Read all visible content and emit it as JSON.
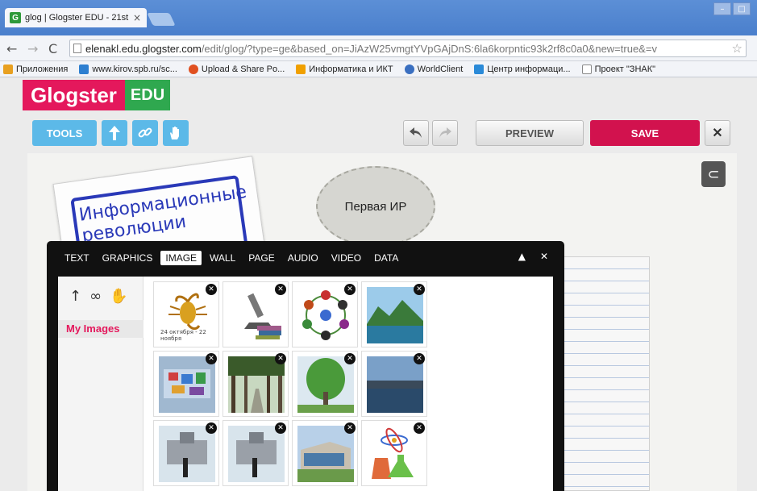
{
  "browser": {
    "tab_title": "glog | Glogster EDU - 21st",
    "tab_close": "×",
    "favicon_letter": "G",
    "url_host": "elenakl.edu.glogster.com",
    "url_path": "/edit/glog/?type=ge&based_on=JiAzW25vmgtYVpGAjDnS:6la6korpntic93k2rf8c0a0&new=true&=v",
    "bookmarks": [
      {
        "label": "Приложения",
        "color": "#e8a020"
      },
      {
        "label": "www.kirov.spb.ru/sc...",
        "color": "#2e7fd0"
      },
      {
        "label": "Upload & Share Po...",
        "color": "#e05020"
      },
      {
        "label": "Информатика и ИКТ",
        "color": "#f0a000"
      },
      {
        "label": "WorldClient",
        "color": "#3a6fc0"
      },
      {
        "label": "Центр информаци...",
        "color": "#2a8ad8"
      },
      {
        "label": "Проект \"ЗНАК\"",
        "color": "#ffffff"
      }
    ]
  },
  "app": {
    "logo_main": "Glogster",
    "logo_edu": "EDU",
    "toolbar": {
      "tools_label": "TOOLS",
      "preview_label": "PREVIEW",
      "save_label": "SAVE",
      "close_label": "✕"
    },
    "canvas": {
      "note_text_line1": "Информационные",
      "note_text_line2": "революции",
      "circle_text": "Первая ИР"
    },
    "panel": {
      "tabs": [
        "TEXT",
        "GRAPHICS",
        "IMAGE",
        "WALL",
        "PAGE",
        "AUDIO",
        "VIDEO",
        "DATA"
      ],
      "active_tab": "IMAGE",
      "my_images_label": "My Images",
      "thumb_caption": "24 октября - 22 ноября"
    }
  },
  "colors": {
    "brand_pink": "#e4185c",
    "brand_green": "#2fa84f",
    "tool_blue": "#5cb9e8",
    "save_red": "#d2124e"
  }
}
